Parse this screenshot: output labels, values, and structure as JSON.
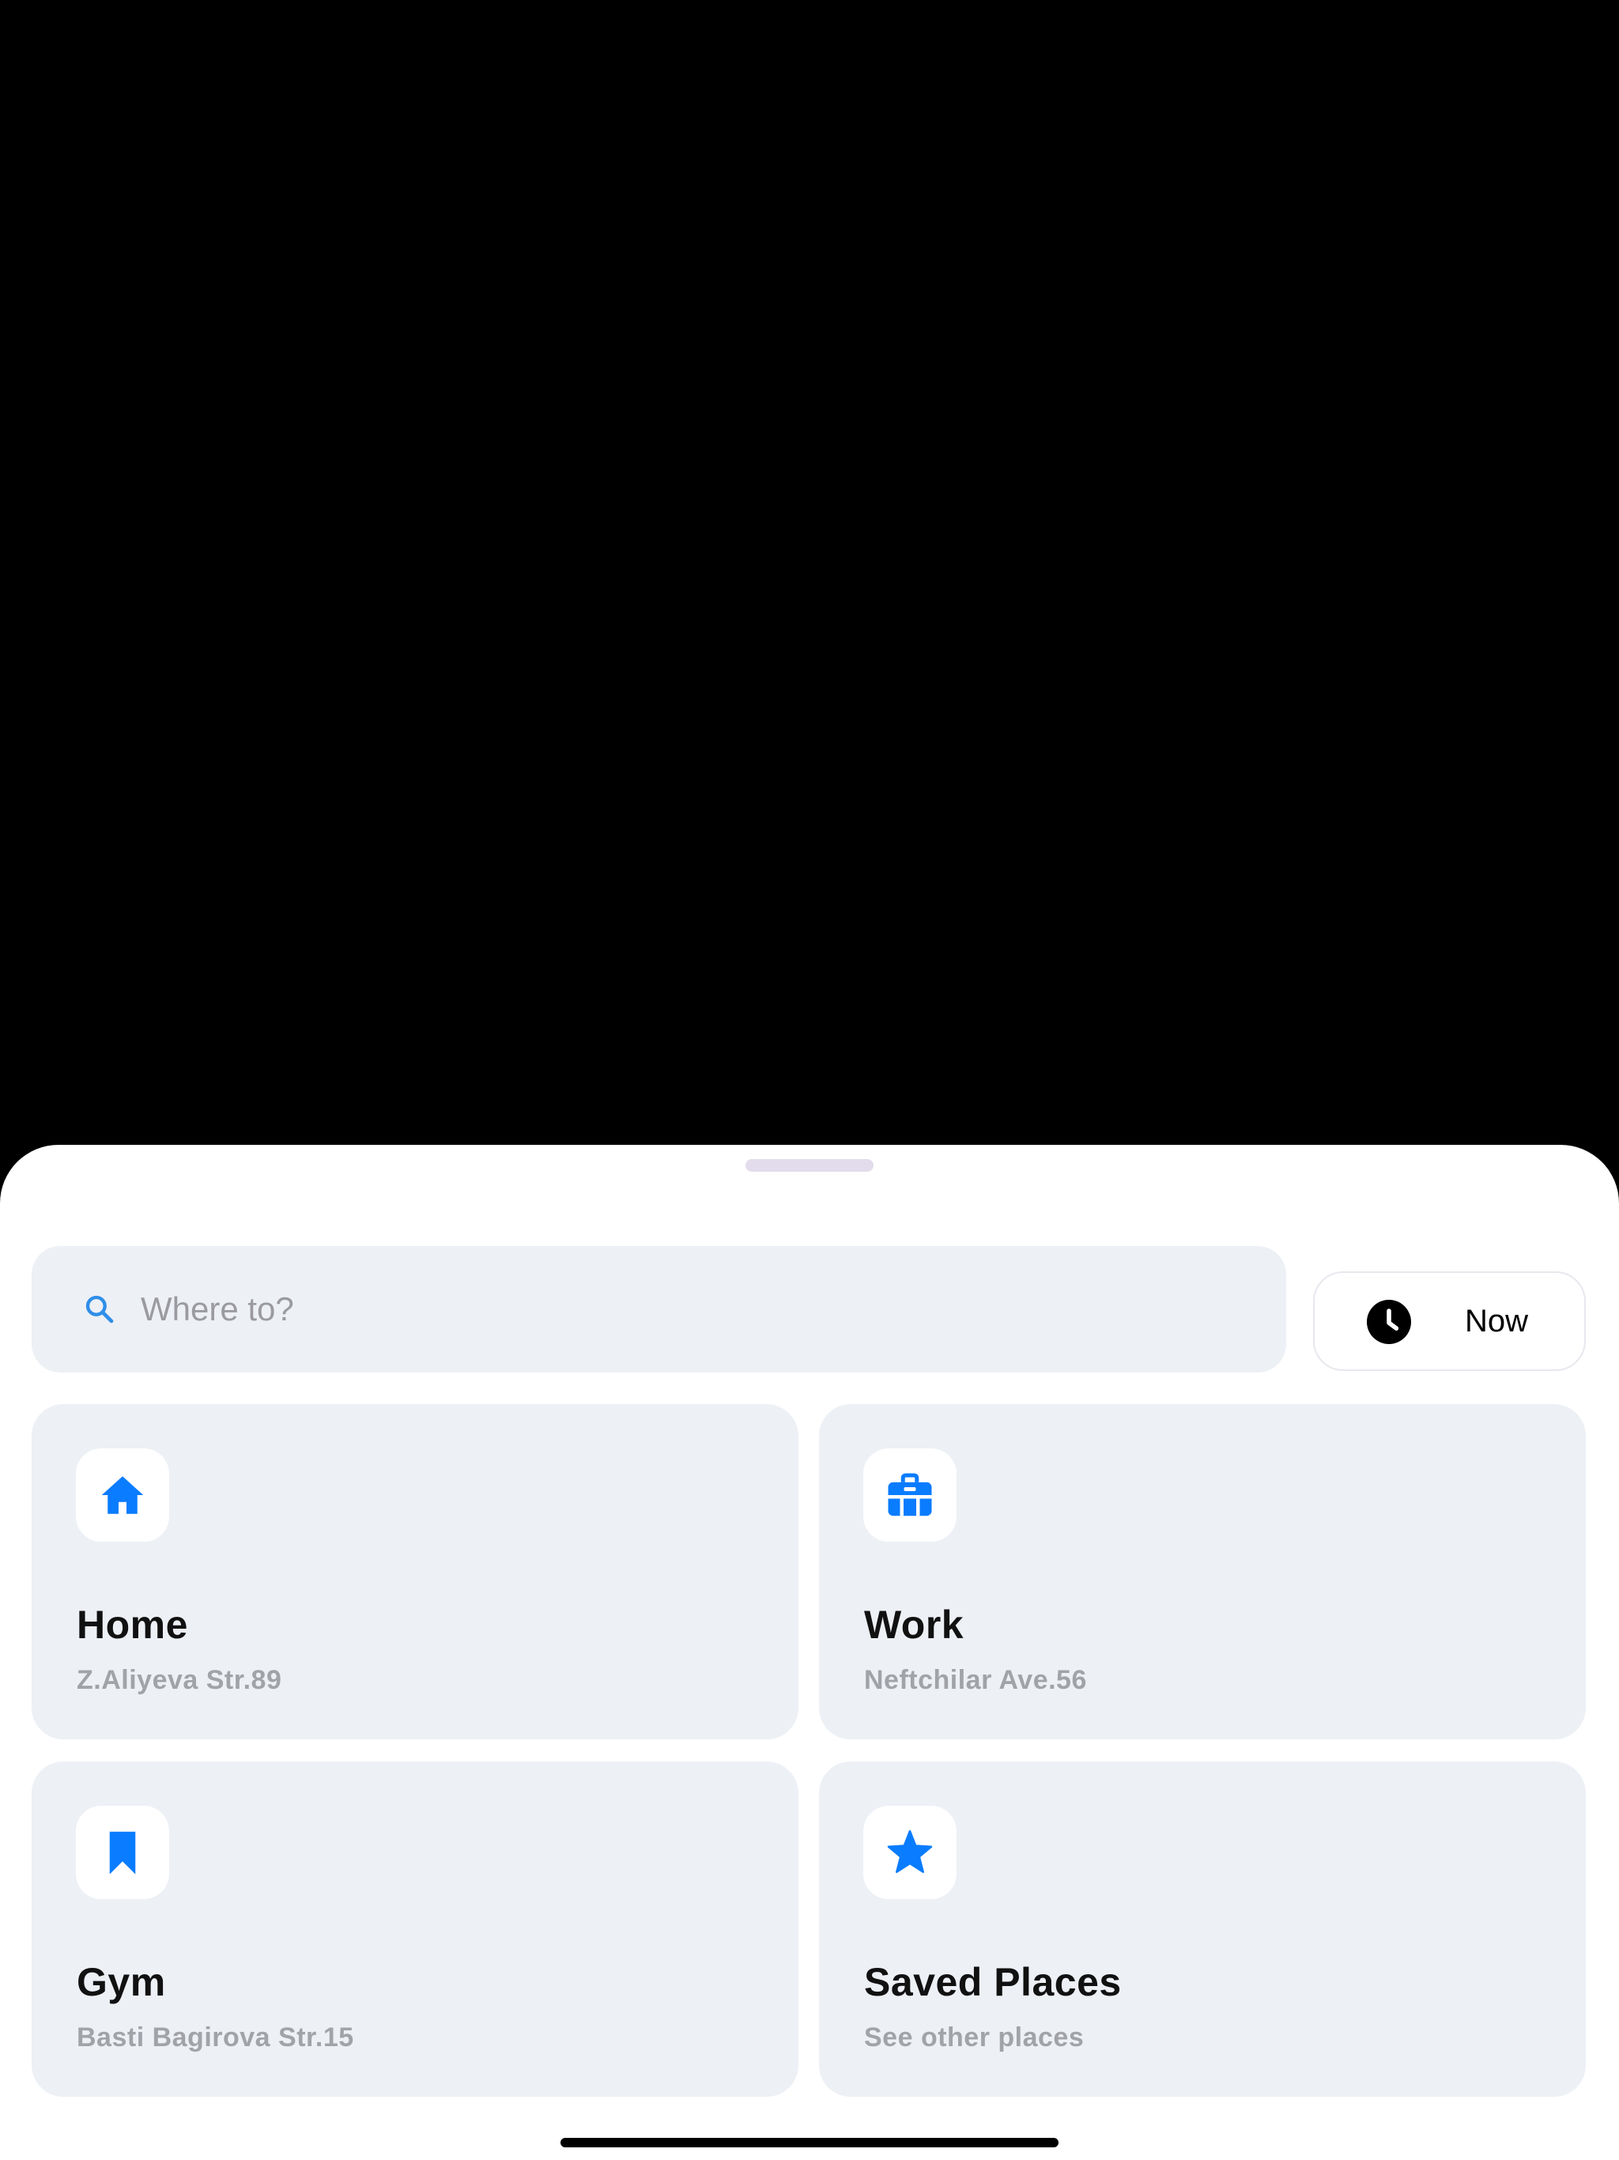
{
  "search": {
    "placeholder": "Where to?",
    "value": ""
  },
  "time_button": {
    "label": "Now",
    "icon": "clock-icon"
  },
  "places": [
    {
      "title": "Home",
      "subtitle": "Z.Aliyeva Str.89",
      "icon": "home-icon"
    },
    {
      "title": "Work",
      "subtitle": "Neftchilar Ave.56",
      "icon": "briefcase-icon"
    },
    {
      "title": "Gym",
      "subtitle": "Basti Bagirova Str.15",
      "icon": "bookmark-icon"
    },
    {
      "title": "Saved Places",
      "subtitle": "See other places",
      "icon": "star-icon"
    }
  ],
  "colors": {
    "accent": "#0a7cff",
    "card_background": "#edf0f5",
    "subtitle_text": "#a1a3a8"
  }
}
